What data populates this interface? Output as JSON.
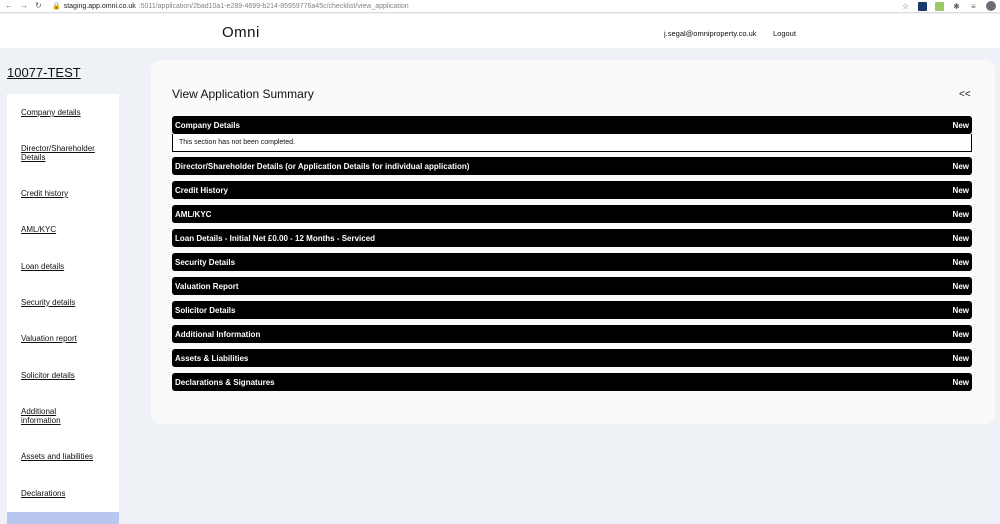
{
  "browser": {
    "url_host": "staging.app.omni.co.uk",
    "url_path": ":5011/application/2bad10a1-e289-4699-b214-85959776a45c/checklist/view_application"
  },
  "header": {
    "brand": "Omni",
    "user_email": "j.segal@omniproperty.co.uk",
    "logout_label": "Logout"
  },
  "application": {
    "id": "10077-TEST"
  },
  "sidebar": {
    "items": [
      {
        "label": "Company details"
      },
      {
        "label": "Director/Shareholder Details"
      },
      {
        "label": "Credit history"
      },
      {
        "label": "AML/KYC"
      },
      {
        "label": "Loan details"
      },
      {
        "label": "Security details"
      },
      {
        "label": "Valuation report"
      },
      {
        "label": "Solicitor details"
      },
      {
        "label": "Additional information"
      },
      {
        "label": "Assets and liabilities"
      },
      {
        "label": "Declarations"
      }
    ]
  },
  "main": {
    "title": "View Application Summary",
    "collapse_label": "<<",
    "sections": [
      {
        "label": "Company Details",
        "status": "New",
        "body": "This section has not been completed."
      },
      {
        "label": "Director/Shareholder Details (or Application Details for individual application)",
        "status": "New"
      },
      {
        "label": "Credit History",
        "status": "New"
      },
      {
        "label": "AML/KYC",
        "status": "New"
      },
      {
        "label": "Loan Details - Initial Net £0.00 - 12 Months - Serviced",
        "status": "New"
      },
      {
        "label": "Security Details",
        "status": "New"
      },
      {
        "label": "Valuation Report",
        "status": "New"
      },
      {
        "label": "Solicitor Details",
        "status": "New"
      },
      {
        "label": "Additional Information",
        "status": "New"
      },
      {
        "label": "Assets & Liabilities",
        "status": "New"
      },
      {
        "label": "Declarations & Signatures",
        "status": "New"
      }
    ]
  }
}
